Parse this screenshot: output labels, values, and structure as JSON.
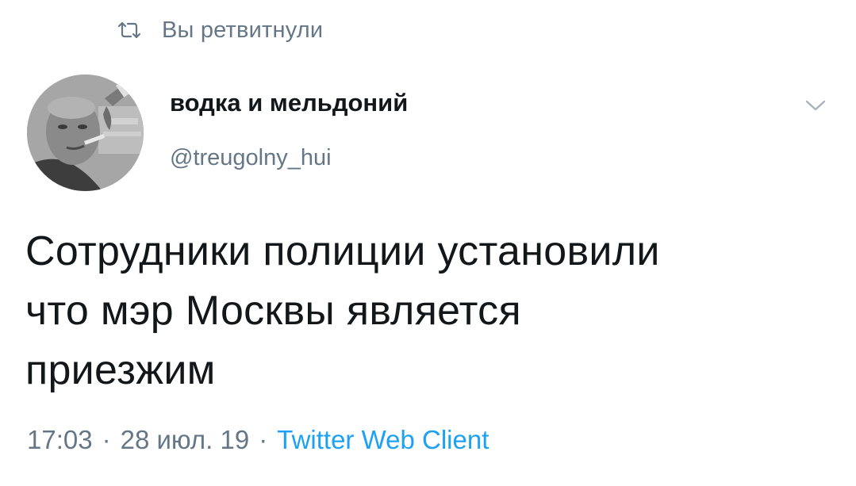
{
  "retweet": {
    "icon": "retweet-icon",
    "label": "Вы ретвитнули"
  },
  "author": {
    "avatar_icon": "avatar",
    "display_name": "водка и мельдоний",
    "handle": "@treugolny_hui"
  },
  "menu": {
    "icon": "chevron-down-icon"
  },
  "tweet": {
    "lines": [
      "Сотрудники полиции установили",
      "что мэр Москвы является",
      "приезжим"
    ]
  },
  "meta": {
    "time": "17:03",
    "separator": "·",
    "date": "28 июл. 19",
    "client": "Twitter Web Client"
  },
  "colors": {
    "muted": "#657786",
    "text": "#14171a",
    "link": "#1da1f2"
  }
}
